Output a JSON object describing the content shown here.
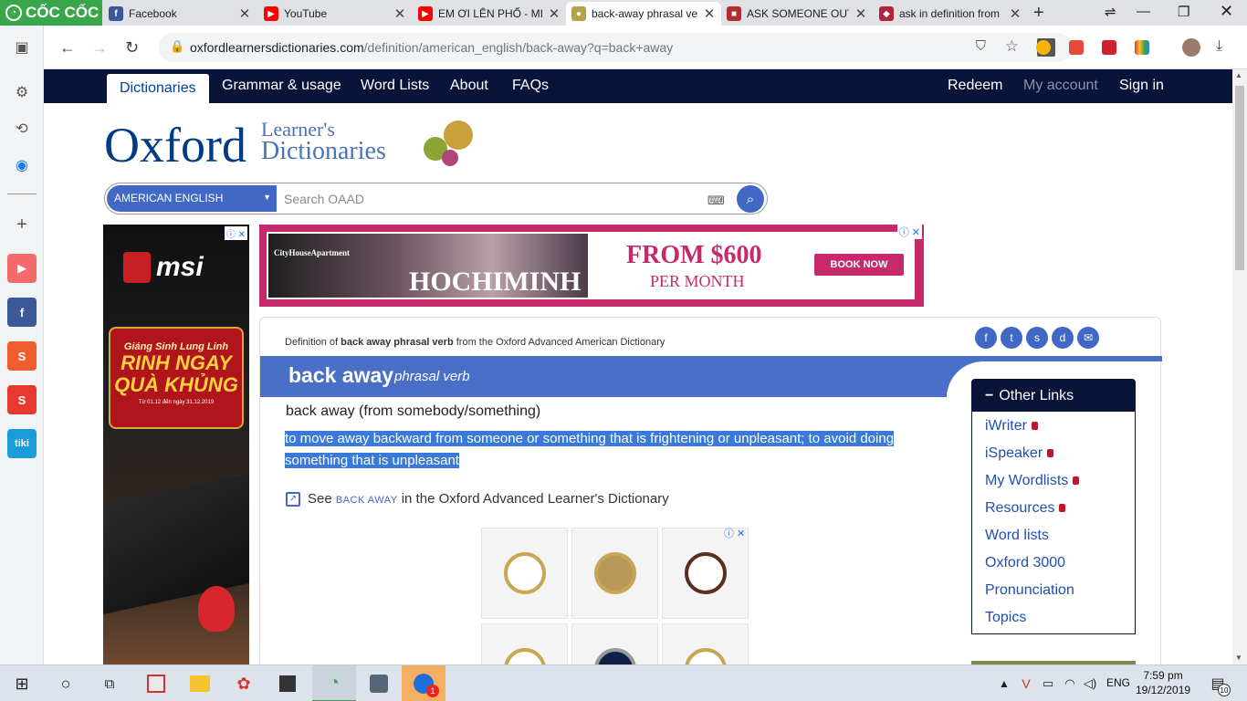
{
  "browser": {
    "brand": "CỐC CỐC",
    "tabs": [
      {
        "title": "Facebook",
        "icon": "facebook-icon",
        "color": "#3b5998"
      },
      {
        "title": "YouTube",
        "icon": "youtube-icon",
        "color": "#ff0000"
      },
      {
        "title": "EM ƠI LÊN PHỐ - MI",
        "icon": "youtube-icon",
        "color": "#ff0000"
      },
      {
        "title": "back-away phrasal ve",
        "icon": "oxford-icon",
        "color": "#b8a14a"
      },
      {
        "title": "ASK SOMEONE OUT",
        "icon": "cambridge-icon",
        "color": "#b52d30"
      },
      {
        "title": "ask in definition from",
        "icon": "dictionary-icon",
        "color": "#b0253c"
      }
    ],
    "url_domain": "oxfordlearnersdictionaries.com",
    "url_path": "/definition/american_english/back-away?q=back+away"
  },
  "sidebar_apps": [
    {
      "name": "youtube",
      "label": "▶",
      "color": "#f0403c"
    },
    {
      "name": "facebook",
      "label": "f",
      "color": "#3b5998"
    },
    {
      "name": "shopee",
      "label": "S",
      "color": "#f05d2c"
    },
    {
      "name": "shopping",
      "label": "S",
      "color": "#e63a2e"
    },
    {
      "name": "tiki",
      "label": "tiki",
      "color": "#1a9cd8"
    }
  ],
  "site": {
    "nav": {
      "dictionaries": "Dictionaries",
      "grammar": "Grammar & usage",
      "word_lists": "Word Lists",
      "about": "About",
      "faqs": "FAQs",
      "redeem": "Redeem",
      "my_account": "My account",
      "sign_in": "Sign in"
    },
    "logo": {
      "oxford": "Oxford",
      "learners": "Learner's",
      "dictionaries": "Dictionaries"
    },
    "search": {
      "language": "AMERICAN ENGLISH",
      "placeholder": "Search OAAD"
    }
  },
  "ads": {
    "left": {
      "brand": "msi",
      "headline1": "Giáng Sinh Lung Linh",
      "headline2": "RINH NGAY",
      "headline3": "QUÀ KHỦNG",
      "dates": "Từ 01.12 đến ngày 31.12.2019"
    },
    "banner": {
      "company": "CityHouseApartment",
      "city": "HOCHIMINH",
      "price": "FROM $600",
      "per": "PER MONTH",
      "cta": "BOOK NOW"
    }
  },
  "entry": {
    "source_prefix": "Definition of",
    "source_word": "back away phrasal verb",
    "source_suffix": "from the Oxford Advanced American Dictionary",
    "headword": "back away",
    "pos": "phrasal verb",
    "phrase": "back away (from somebody/something)",
    "definition": "to move away backward from someone or something that is frightening or unpleasant; to avoid doing something that is unpleasant",
    "see_prefix": "See",
    "see_word": "BACK AWAY",
    "see_suffix": "in the Oxford Advanced Learner's Dictionary"
  },
  "other_links": {
    "title": "Other Links",
    "items": [
      {
        "label": "iWriter",
        "locked": true
      },
      {
        "label": "iSpeaker",
        "locked": true
      },
      {
        "label": "My Wordlists",
        "locked": true
      },
      {
        "label": "Resources",
        "locked": true
      },
      {
        "label": "Word lists",
        "locked": false
      },
      {
        "label": "Oxford 3000",
        "locked": false
      },
      {
        "label": "Pronunciation",
        "locked": false
      },
      {
        "label": "Topics",
        "locked": false
      }
    ]
  },
  "taskbar": {
    "lang": "ENG",
    "time": "7:59 pm",
    "date": "19/12/2019",
    "notifications": "10"
  }
}
